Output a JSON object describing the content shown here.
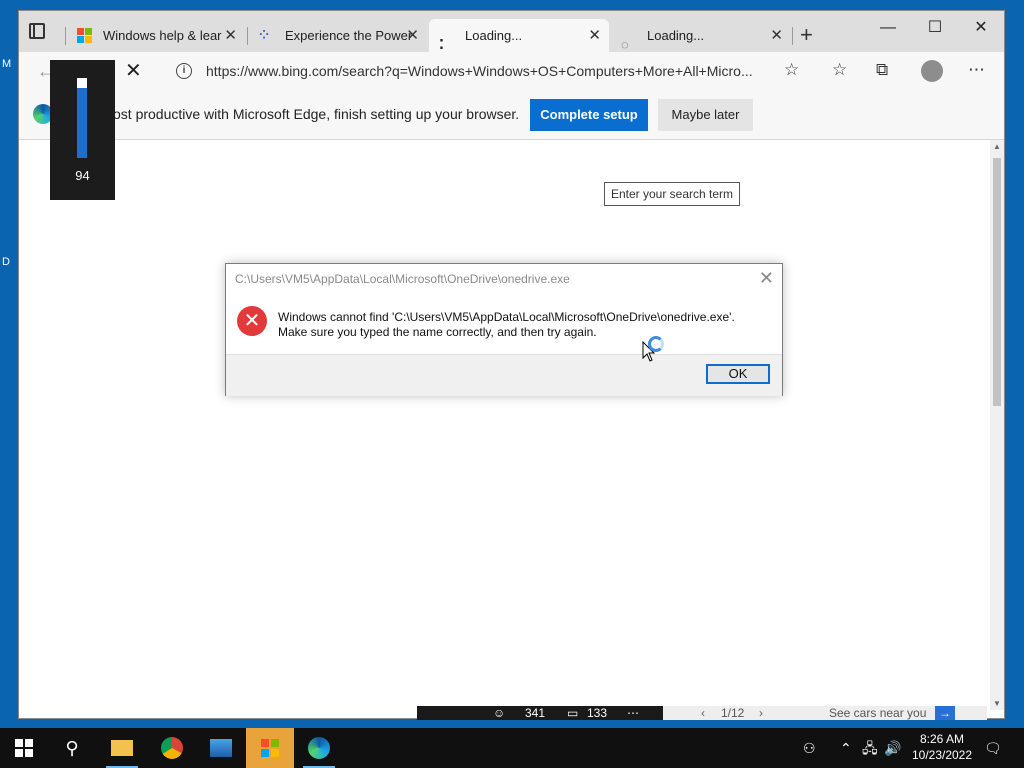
{
  "desktop": {
    "left_chars": [
      "M",
      "D"
    ]
  },
  "browser": {
    "tabs": [
      {
        "title": "Windows help & lear",
        "icon": "microsoft-logo-icon"
      },
      {
        "title": "Experience the Power",
        "icon": "loading-dots-icon"
      },
      {
        "title": "Loading...",
        "icon": "loading-dots-icon"
      },
      {
        "title": "Loading...",
        "icon": "loading-spinner-icon"
      }
    ],
    "new_tab_label": "+",
    "address": "https://www.bing.com/search?q=Windows+Windows+OS+Computers+More+All+Micro...",
    "infobar": {
      "text": "ost productive with Microsoft Edge, finish setting up your browser.",
      "primary_button": "Complete setup",
      "secondary_button": "Maybe later"
    },
    "search_placeholder": "Enter your search term",
    "bottom_strip": {
      "reactions": "341",
      "comments": "133",
      "pager": "1/12",
      "link": "See cars near you"
    }
  },
  "volume": {
    "value": "94",
    "level": 0.94
  },
  "dialog": {
    "title": "C:\\Users\\VM5\\AppData\\Local\\Microsoft\\OneDrive\\onedrive.exe",
    "message_line1": "Windows cannot find 'C:\\Users\\VM5\\AppData\\Local\\Microsoft\\OneDrive\\onedrive.exe'.",
    "message_line2": "Make sure you typed the name correctly, and then try again.",
    "ok_label": "OK"
  },
  "taskbar": {
    "time": "8:26 AM",
    "date": "10/23/2022",
    "apps": [
      "start",
      "search",
      "file-explorer",
      "chrome",
      "photos",
      "microsoft-store",
      "edge"
    ]
  }
}
